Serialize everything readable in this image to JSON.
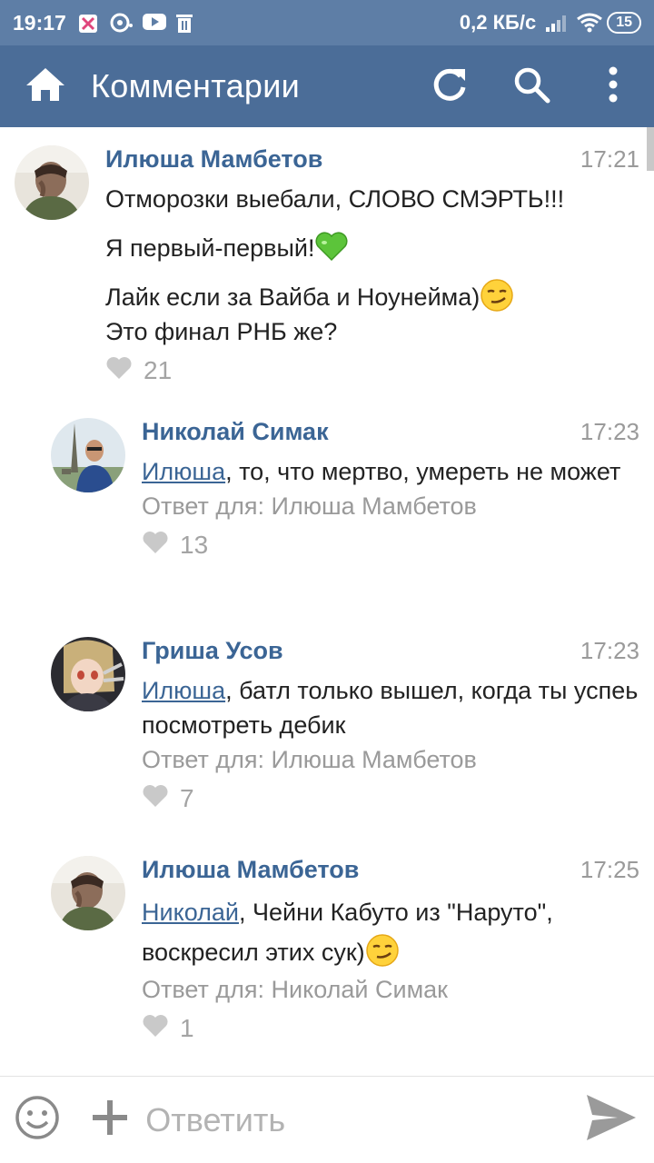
{
  "status_bar": {
    "time": "19:17",
    "speed": "0,2 КБ/с",
    "battery": "15"
  },
  "app_bar": {
    "title": "Комментарии",
    "icons": [
      "home-icon",
      "refresh-icon",
      "search-icon",
      "more-vert-icon"
    ]
  },
  "comments": [
    {
      "author": "Илюша Мамбетов",
      "time": "17:21",
      "lines": [
        "Отморозки выебали, СЛОВО СМЭРТЬ!!!",
        "Я первый-первый!",
        "Лайк если за Вайба и Ноунейма)",
        "Это финал РНБ же?"
      ],
      "likes": "21"
    },
    {
      "author": "Николай Симак",
      "time": "17:23",
      "mention": "Илюша",
      "text": ", то, что мертво, умереть не может",
      "reply_prefix": "Ответ для: ",
      "reply_to": "Илюша Мамбетов",
      "likes": "13"
    },
    {
      "author": "Гриша Усов",
      "time": "17:23",
      "mention": "Илюша",
      "text": ", батл только вышел, когда ты успеь посмотреть дебик",
      "reply_prefix": "Ответ для: ",
      "reply_to": "Илюша Мамбетов",
      "likes": "7"
    },
    {
      "author": "Илюша Мамбетов",
      "time": "17:25",
      "mention": "Николай",
      "text": ", Чейни Кабуто из \"Наруто\", воскресил этих сук)",
      "reply_prefix": "Ответ для: ",
      "reply_to": "Николай Симак",
      "likes": "1"
    }
  ],
  "compose": {
    "placeholder": "Ответить"
  },
  "colors": {
    "status_bar": "#5e7ea6",
    "app_bar": "#4b6d98",
    "author": "#3b6595",
    "muted": "#9a9a9a"
  }
}
